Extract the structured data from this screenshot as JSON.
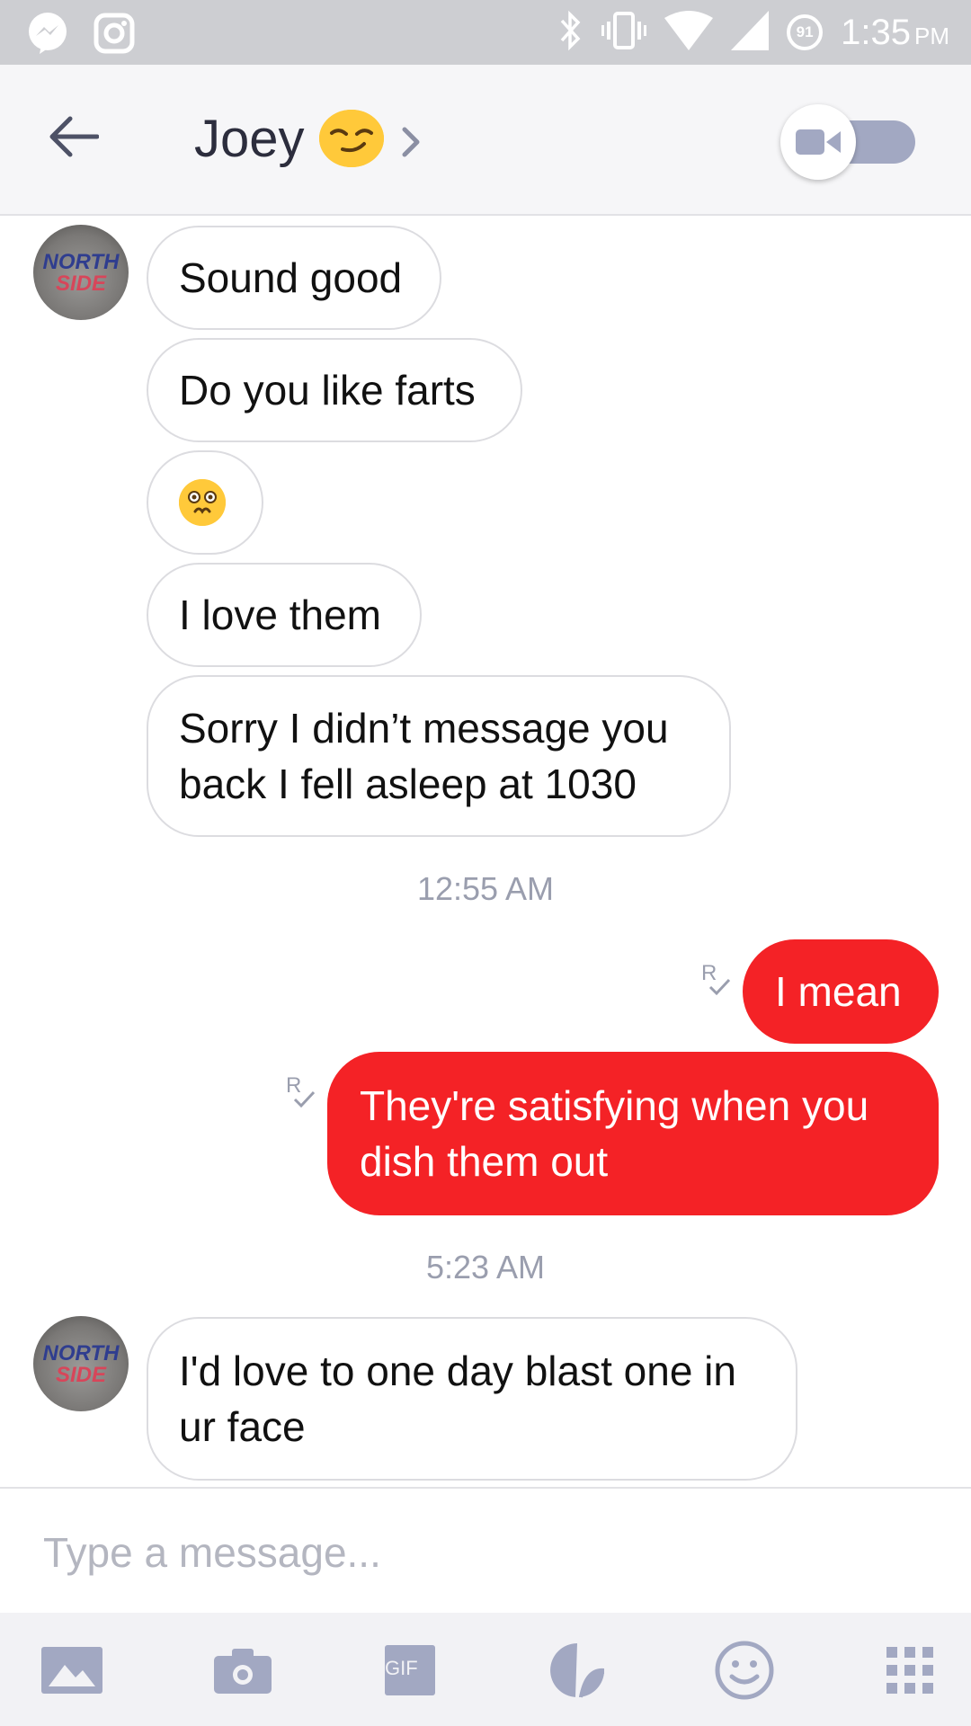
{
  "status_bar": {
    "time": "1:35",
    "ampm": "PM",
    "battery": "91",
    "icons": [
      "messenger-icon",
      "instagram-icon",
      "bluetooth-icon",
      "vibrate-icon",
      "wifi-icon",
      "signal-icon",
      "battery-icon"
    ]
  },
  "header": {
    "back_icon": "arrow-left-icon",
    "contact_name": "Joey",
    "contact_emoji": "smirking-face-emoji",
    "chevron_icon": "chevron-right-icon",
    "video_toggle_icon": "video-camera-icon",
    "colors": {
      "toggle_track": "#a2a8c2"
    }
  },
  "messages": {
    "incoming_avatar_text_line1": "NORTH",
    "incoming_avatar_text_line2": "SIDE",
    "m1": "Sound good",
    "m2": "Do you like farts",
    "m3_emoji": "flushed-face-emoji",
    "m4": "I love them",
    "m5_line1": "Sorry I didn’t message you",
    "m5_line2": "back I fell asleep at 1030",
    "time1": "12:55 AM",
    "m6": "I mean",
    "m7_line1": "They're satisfying when you",
    "m7_line2": "dish them out",
    "read_receipt": "R",
    "time2": "5:23 AM",
    "m8_line1": "I'd love to one day blast one in",
    "m8_line2": "ur face"
  },
  "composer": {
    "placeholder": "Type a message..."
  },
  "toolbar": {
    "gif_label": "GIF",
    "icons": [
      "photo-icon",
      "camera-icon",
      "gif-icon",
      "sticker-icon",
      "emoji-icon",
      "more-apps-icon"
    ]
  },
  "colors": {
    "outgoing_bubble": "#f42226",
    "incoming_border": "#dcdce0",
    "timestamp": "#9a9eae",
    "status_bar": "#cdced2"
  }
}
